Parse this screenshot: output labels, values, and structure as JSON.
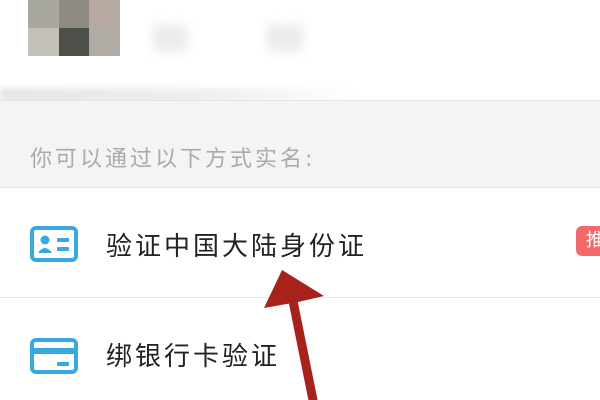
{
  "profile": {
    "avatar_colors": [
      "#a8a8a0",
      "#8f8a84",
      "#b5a9a2",
      "#c2c0b8",
      "#4c5048",
      "#b0aca5"
    ]
  },
  "section": {
    "hint": "你可以通过以下方式实名:"
  },
  "options": [
    {
      "label": "验证中国大陆身份证",
      "icon": "id-card-icon",
      "badge": "推"
    },
    {
      "label": "绑银行卡验证",
      "icon": "bank-card-icon"
    }
  ],
  "colors": {
    "icon": "#3aa8e0",
    "badge": "#f26a6a",
    "arrow": "#a8221c"
  }
}
